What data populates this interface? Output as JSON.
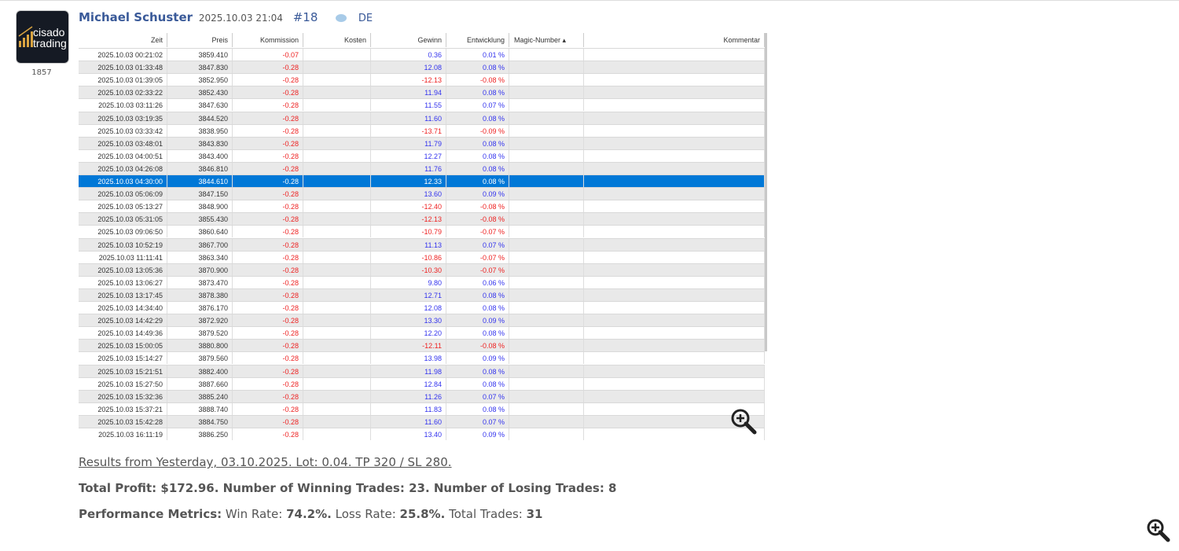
{
  "post": {
    "author": "Michael Schuster",
    "date": "2025.10.03 21:04",
    "number": "#18",
    "language": "DE",
    "rating": "1857",
    "avatar_text": [
      "cisado",
      "trading"
    ]
  },
  "table": {
    "columns": [
      "Zeit",
      "Preis",
      "Kommission",
      "Kosten",
      "Gewinn",
      "Entwicklung",
      "Magic-Number ▴",
      "Kommentar"
    ],
    "selected_row": 10,
    "rows": [
      [
        "2025.10.03 00:21:02",
        "3859.410",
        "-0.07",
        "",
        "0.36",
        "0.01 %"
      ],
      [
        "2025.10.03 01:33:48",
        "3847.830",
        "-0.28",
        "",
        "12.08",
        "0.08 %"
      ],
      [
        "2025.10.03 01:39:05",
        "3852.950",
        "-0.28",
        "",
        "-12.13",
        "-0.08 %"
      ],
      [
        "2025.10.03 02:33:22",
        "3852.430",
        "-0.28",
        "",
        "11.94",
        "0.08 %"
      ],
      [
        "2025.10.03 03:11:26",
        "3847.630",
        "-0.28",
        "",
        "11.55",
        "0.07 %"
      ],
      [
        "2025.10.03 03:19:35",
        "3844.520",
        "-0.28",
        "",
        "11.60",
        "0.08 %"
      ],
      [
        "2025.10.03 03:33:42",
        "3838.950",
        "-0.28",
        "",
        "-13.71",
        "-0.09 %"
      ],
      [
        "2025.10.03 03:48:01",
        "3843.830",
        "-0.28",
        "",
        "11.79",
        "0.08 %"
      ],
      [
        "2025.10.03 04:00:51",
        "3843.400",
        "-0.28",
        "",
        "12.27",
        "0.08 %"
      ],
      [
        "2025.10.03 04:26:08",
        "3846.810",
        "-0.28",
        "",
        "11.76",
        "0.08 %"
      ],
      [
        "2025.10.03 04:30:00",
        "3844.610",
        "-0.28",
        "",
        "12.33",
        "0.08 %"
      ],
      [
        "2025.10.03 05:06:09",
        "3847.150",
        "-0.28",
        "",
        "13.60",
        "0.09 %"
      ],
      [
        "2025.10.03 05:13:27",
        "3848.900",
        "-0.28",
        "",
        "-12.40",
        "-0.08 %"
      ],
      [
        "2025.10.03 05:31:05",
        "3855.430",
        "-0.28",
        "",
        "-12.13",
        "-0.08 %"
      ],
      [
        "2025.10.03 09:06:50",
        "3860.640",
        "-0.28",
        "",
        "-10.79",
        "-0.07 %"
      ],
      [
        "2025.10.03 10:52:19",
        "3867.700",
        "-0.28",
        "",
        "11.13",
        "0.07 %"
      ],
      [
        "2025.10.03 11:11:41",
        "3863.340",
        "-0.28",
        "",
        "-10.86",
        "-0.07 %"
      ],
      [
        "2025.10.03 13:05:36",
        "3870.900",
        "-0.28",
        "",
        "-10.30",
        "-0.07 %"
      ],
      [
        "2025.10.03 13:06:27",
        "3873.470",
        "-0.28",
        "",
        "9.80",
        "0.06 %"
      ],
      [
        "2025.10.03 13:17:45",
        "3878.380",
        "-0.28",
        "",
        "12.71",
        "0.08 %"
      ],
      [
        "2025.10.03 14:34:40",
        "3876.170",
        "-0.28",
        "",
        "12.08",
        "0.08 %"
      ],
      [
        "2025.10.03 14:42:29",
        "3872.920",
        "-0.28",
        "",
        "13.30",
        "0.09 %"
      ],
      [
        "2025.10.03 14:49:36",
        "3879.520",
        "-0.28",
        "",
        "12.20",
        "0.08 %"
      ],
      [
        "2025.10.03 15:00:05",
        "3880.800",
        "-0.28",
        "",
        "-12.11",
        "-0.08 %"
      ],
      [
        "2025.10.03 15:14:27",
        "3879.560",
        "-0.28",
        "",
        "13.98",
        "0.09 %"
      ],
      [
        "2025.10.03 15:21:51",
        "3882.400",
        "-0.28",
        "",
        "11.98",
        "0.08 %"
      ],
      [
        "2025.10.03 15:27:50",
        "3887.660",
        "-0.28",
        "",
        "12.84",
        "0.08 %"
      ],
      [
        "2025.10.03 15:32:36",
        "3885.240",
        "-0.28",
        "",
        "11.26",
        "0.07 %"
      ],
      [
        "2025.10.03 15:37:21",
        "3888.740",
        "-0.28",
        "",
        "11.83",
        "0.08 %"
      ],
      [
        "2025.10.03 15:42:28",
        "3884.750",
        "-0.28",
        "",
        "11.60",
        "0.07 %"
      ],
      [
        "2025.10.03 16:11:19",
        "3886.250",
        "-0.28",
        "",
        "13.40",
        "0.09 %"
      ]
    ]
  },
  "description": {
    "line1": "Results from Yesterday, 03.10.2025. Lot: 0.04. TP 320 / SL 280.",
    "line2": "Total Profit: $172.96. Number of Winning Trades: 23. Number of Losing Trades: 8",
    "line3_label": "Performance Metrics:",
    "win_label": "Win Rate:",
    "win_value": "74.2%.",
    "loss_label": "Loss Rate:",
    "loss_value": "25.8%.",
    "total_label": "Total Trades:",
    "total_value": "31"
  },
  "colors": {
    "positive": "#3333ee",
    "negative": "#ee2222",
    "selected": "#0078d7",
    "author": "#3a5a99"
  }
}
